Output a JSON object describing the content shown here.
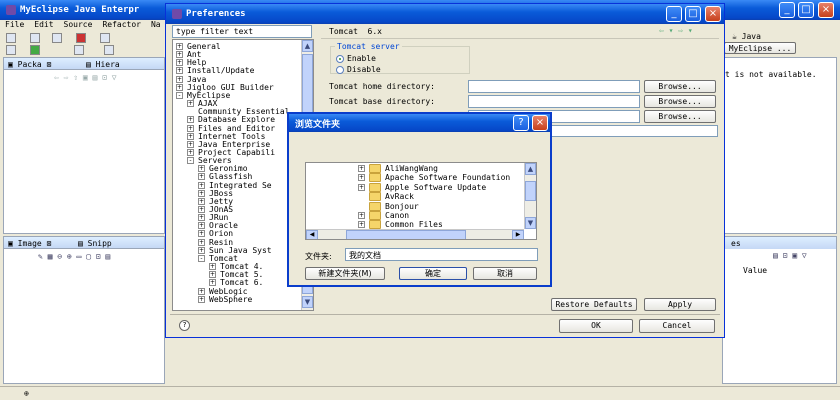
{
  "main_window": {
    "title": "MyEclipse Java Enterpr",
    "menu": [
      "File",
      "Edit",
      "Source",
      "Refactor",
      "Na"
    ],
    "left_tabs": [
      "Packa",
      "Hiera"
    ],
    "bottom_tabs": [
      "Image",
      "Snipp"
    ],
    "right": {
      "perspective_label": "Java",
      "perspective_btn": "MyEclipse ...",
      "outline_msg": "t is not available.",
      "props_tab": "es",
      "value_header": "Value"
    }
  },
  "prefs": {
    "title": "Preferences",
    "filter_value": "type filter text",
    "page_title": "Tomcat  6.x",
    "tree": [
      {
        "label": "General",
        "indent": 0,
        "exp": "+"
      },
      {
        "label": "Ant",
        "indent": 0,
        "exp": "+"
      },
      {
        "label": "Help",
        "indent": 0,
        "exp": "+"
      },
      {
        "label": "Install/Update",
        "indent": 0,
        "exp": "+"
      },
      {
        "label": "Java",
        "indent": 0,
        "exp": "+"
      },
      {
        "label": "Jigloo GUI Builder",
        "indent": 0,
        "exp": "+"
      },
      {
        "label": "MyEclipse",
        "indent": 0,
        "exp": "-"
      },
      {
        "label": "AJAX",
        "indent": 1,
        "exp": "+"
      },
      {
        "label": "Community Essential",
        "indent": 1,
        "exp": ""
      },
      {
        "label": "Database Explore",
        "indent": 1,
        "exp": "+"
      },
      {
        "label": "Files and Editor",
        "indent": 1,
        "exp": "+"
      },
      {
        "label": "Internet Tools",
        "indent": 1,
        "exp": "+"
      },
      {
        "label": "Java Enterprise",
        "indent": 1,
        "exp": "+"
      },
      {
        "label": "Project Capabili",
        "indent": 1,
        "exp": "+"
      },
      {
        "label": "Servers",
        "indent": 1,
        "exp": "-"
      },
      {
        "label": "Geronimo",
        "indent": 2,
        "exp": "+"
      },
      {
        "label": "Glassfish",
        "indent": 2,
        "exp": "+"
      },
      {
        "label": "Integrated Se",
        "indent": 2,
        "exp": "+"
      },
      {
        "label": "JBoss",
        "indent": 2,
        "exp": "+"
      },
      {
        "label": "Jetty",
        "indent": 2,
        "exp": "+"
      },
      {
        "label": "JOnAS",
        "indent": 2,
        "exp": "+"
      },
      {
        "label": "JRun",
        "indent": 2,
        "exp": "+"
      },
      {
        "label": "Oracle",
        "indent": 2,
        "exp": "+"
      },
      {
        "label": "Orion",
        "indent": 2,
        "exp": "+"
      },
      {
        "label": "Resin",
        "indent": 2,
        "exp": "+"
      },
      {
        "label": "Sun Java Syst",
        "indent": 2,
        "exp": "+"
      },
      {
        "label": "Tomcat",
        "indent": 2,
        "exp": "-"
      },
      {
        "label": "Tomcat  4.",
        "indent": 3,
        "exp": "+"
      },
      {
        "label": "Tomcat  5.",
        "indent": 3,
        "exp": "+"
      },
      {
        "label": "Tomcat  6.",
        "indent": 3,
        "exp": "+"
      },
      {
        "label": "WebLogic",
        "indent": 2,
        "exp": "+"
      },
      {
        "label": "WebSphere",
        "indent": 2,
        "exp": "+"
      }
    ],
    "server_group": "Tomcat server",
    "enable": "Enable",
    "disable": "Disable",
    "home_dir": "Tomcat home directory:",
    "base_dir": "Tomcat base directory:",
    "browse": "Browse...",
    "restore": "Restore Defaults",
    "apply": "Apply",
    "ok": "OK",
    "cancel": "Cancel",
    "help_icon": "help-icon"
  },
  "folder_dialog": {
    "title": "浏览文件夹",
    "help": "?",
    "close": "×",
    "folders": [
      {
        "label": "AliWangWang",
        "exp": "+"
      },
      {
        "label": "Apache Software Foundation",
        "exp": "+"
      },
      {
        "label": "Apple Software Update",
        "exp": "+"
      },
      {
        "label": "AvRack",
        "exp": ""
      },
      {
        "label": "Bonjour",
        "exp": ""
      },
      {
        "label": "Canon",
        "exp": "+"
      },
      {
        "label": "Common Files",
        "exp": "+"
      }
    ],
    "folder_label": "文件夹:",
    "folder_value": "我的文档",
    "new_folder": "新建文件夹(M)",
    "ok": "确定",
    "cancel": "取消"
  }
}
